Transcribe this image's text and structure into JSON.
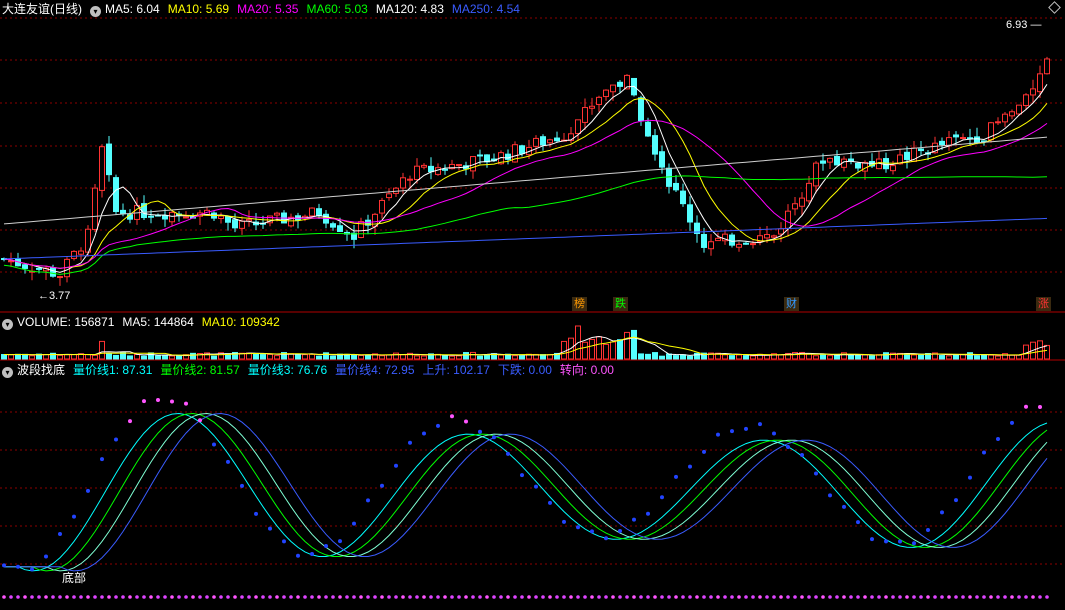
{
  "main_header": {
    "title": "大连友谊(日线)",
    "ma": [
      {
        "label": "MA5: 6.04",
        "color": "#ffffff"
      },
      {
        "label": "MA10: 5.69",
        "color": "#ffff00"
      },
      {
        "label": "MA20: 5.35",
        "color": "#ff00ff"
      },
      {
        "label": "MA60: 5.03",
        "color": "#00ff00"
      },
      {
        "label": "MA120: 4.83",
        "color": "#ffffff"
      },
      {
        "label": "MA250: 4.54",
        "color": "#3a5cff"
      }
    ]
  },
  "price_labels": {
    "high": "6.93",
    "low": "3.77"
  },
  "event_badges": [
    {
      "text": "榜",
      "color": "#ff9900"
    },
    {
      "text": "跌",
      "color": "#00ff00"
    },
    {
      "text": "财",
      "color": "#3399ff"
    },
    {
      "text": "涨",
      "color": "#ff3333"
    }
  ],
  "volume_header": {
    "items": [
      {
        "label": "VOLUME: 156871",
        "color": "#ffffff"
      },
      {
        "label": "MA5: 144864",
        "color": "#ffffff"
      },
      {
        "label": "MA10: 109342",
        "color": "#ffff00"
      }
    ]
  },
  "indicator_header": {
    "items": [
      {
        "label": "波段找底",
        "color": "#ffffff"
      },
      {
        "label": "量价线1: 87.31",
        "color": "#00ffff"
      },
      {
        "label": "量价线2: 81.57",
        "color": "#00ff00"
      },
      {
        "label": "量价线3: 76.76",
        "color": "#00ffff"
      },
      {
        "label": "量价线4: 72.95",
        "color": "#3a5cff"
      },
      {
        "label": "上升: 102.17",
        "color": "#3a5cff"
      },
      {
        "label": "下跌: 0.00",
        "color": "#3a5cff"
      },
      {
        "label": "转向: 0.00",
        "color": "#ff55ff"
      }
    ]
  },
  "indicator_label": "底部",
  "colors": {
    "up": "#ff3333",
    "down": "#54ffff",
    "grid": "#8b0000",
    "separator": "#b00000"
  }
}
